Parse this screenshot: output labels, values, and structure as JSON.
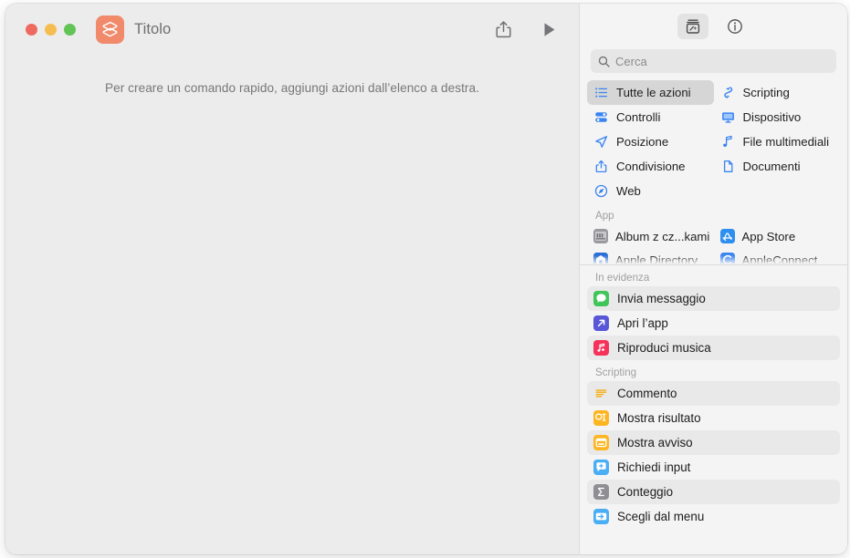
{
  "window": {
    "title": "Titolo",
    "app_icon": "shortcuts-app-icon",
    "traffic_lights": {
      "close": "close-window-button",
      "minimize": "minimize-window-button",
      "zoom": "zoom-window-button"
    },
    "colors": {
      "accent_blue": "#3a84f2",
      "app_icon_bg": "#f08a6b",
      "window_bg": "#ececec",
      "library_bg": "#f4f4f4",
      "selected_row": "#e9e9e9",
      "selected_category": "#d6d6d6"
    }
  },
  "toolbar": {
    "share_label": "Condividi",
    "share_icon": "share-icon",
    "run_label": "Esegui",
    "run_icon": "play-icon"
  },
  "editor": {
    "empty_state_text": "Per creare un comando rapido, aggiungi azioni dall’elenco a destra."
  },
  "library": {
    "toolbar": {
      "action_library_label": "Libreria azioni",
      "action_library_icon": "action-library-icon",
      "action_library_active": true,
      "info_label": "Informazioni",
      "info_icon": "info-circle-icon"
    },
    "search": {
      "placeholder": "Cerca",
      "value": "",
      "icon": "search-icon"
    },
    "categories": [
      {
        "label": "Tutte le azioni",
        "icon": "list-bullet-icon",
        "selected": true
      },
      {
        "label": "Scripting",
        "icon": "scripting-icon",
        "selected": false
      },
      {
        "label": "Controlli",
        "icon": "sliders-icon",
        "selected": false
      },
      {
        "label": "Dispositivo",
        "icon": "display-icon",
        "selected": false
      },
      {
        "label": "Posizione",
        "icon": "location-arrow-icon",
        "selected": false
      },
      {
        "label": "File multimediali",
        "icon": "music-note-icon",
        "selected": false
      },
      {
        "label": "Condivisione",
        "icon": "share-up-icon",
        "selected": false
      },
      {
        "label": "Documenti",
        "icon": "document-icon",
        "selected": false
      },
      {
        "label": "Web",
        "icon": "safari-compass-icon",
        "selected": false
      }
    ],
    "app_section": {
      "header": "App",
      "items": [
        {
          "label": "Album z cz...kami",
          "icon": "album-app-icon",
          "color": "#8c8c90"
        },
        {
          "label": "App Store",
          "icon": "app-store-icon",
          "color": "#2f8fef"
        },
        {
          "label": "Apple Directory",
          "icon": "apple-directory-icon",
          "color": "#2a6fd6"
        },
        {
          "label": "AppleConnect",
          "icon": "appleconnect-icon",
          "color": "#3a84f2"
        }
      ]
    },
    "featured_section": {
      "header": "In evidenza",
      "items": [
        {
          "label": "Invia messaggio",
          "icon": "messages-icon",
          "color": "#3fc55a",
          "alt": true
        },
        {
          "label": "Apri l’app",
          "icon": "open-app-icon",
          "color": "#5a56d8",
          "alt": false
        },
        {
          "label": "Riproduci musica",
          "icon": "music-app-icon",
          "color": "#f4325a",
          "alt": true
        }
      ]
    },
    "scripting_section": {
      "header": "Scripting",
      "items": [
        {
          "label": "Commento",
          "icon": "comment-lines-icon",
          "color": "#f4b223",
          "alt": true
        },
        {
          "label": "Mostra risultato",
          "icon": "show-result-icon",
          "color": "#fdb622",
          "alt": false
        },
        {
          "label": "Mostra avviso",
          "icon": "show-alert-icon",
          "color": "#fdb622",
          "alt": true
        },
        {
          "label": "Richiedi input",
          "icon": "ask-input-icon",
          "color": "#4aaef5",
          "alt": false
        },
        {
          "label": "Conteggio",
          "icon": "count-sigma-icon",
          "color": "#8e8e93",
          "alt": true
        },
        {
          "label": "Scegli dal menu",
          "icon": "choose-menu-icon",
          "color": "#4aaef5",
          "alt": false
        }
      ]
    }
  }
}
